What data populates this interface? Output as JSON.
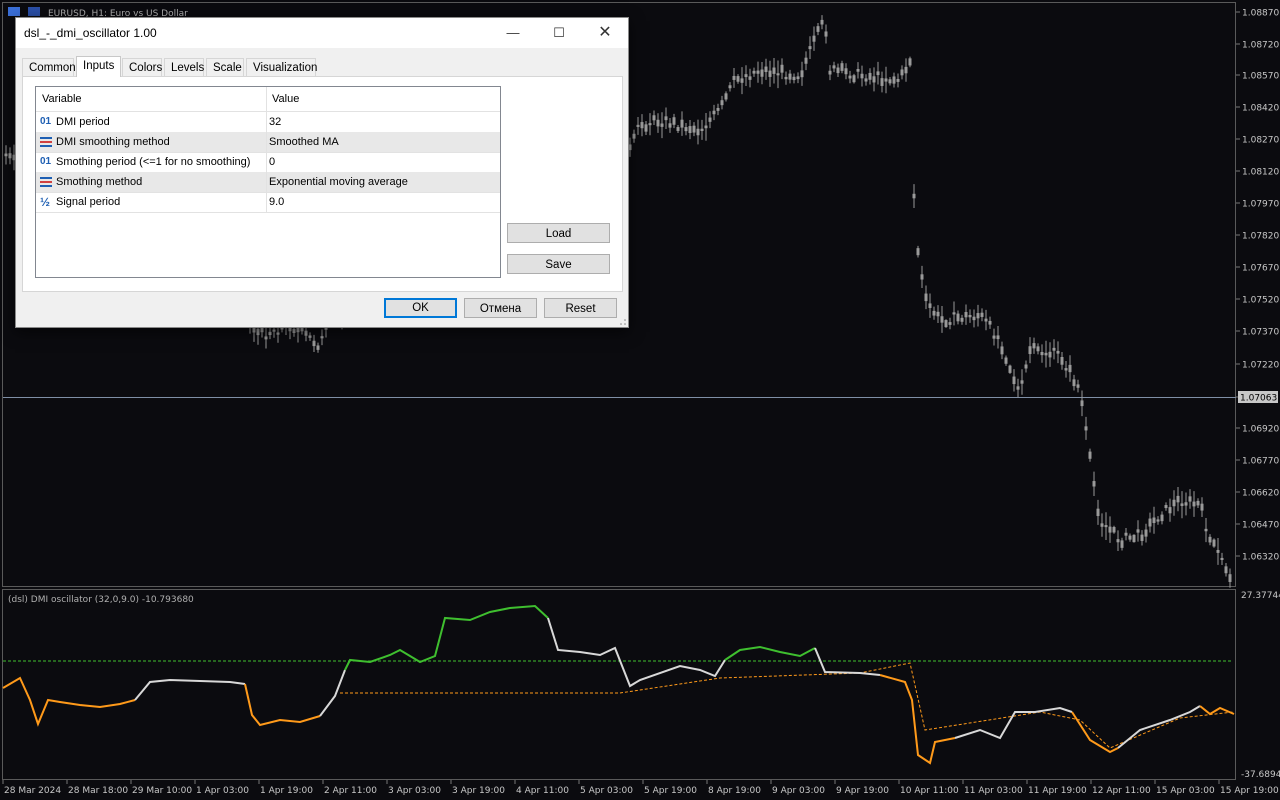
{
  "chart_window": {
    "title": "EURUSD, H1:  Euro vs US Dollar",
    "current_price": "1.07063",
    "price_labels": [
      "1.08870",
      "1.08720",
      "1.08570",
      "1.08420",
      "1.08270",
      "1.08120",
      "1.07970",
      "1.07820",
      "1.07670",
      "1.07520",
      "1.07370",
      "1.07220",
      "1.07063",
      "1.06920",
      "1.06770",
      "1.06620",
      "1.06470",
      "1.06320"
    ],
    "time_labels": [
      "28 Mar 2024",
      "28 Mar 18:00",
      "29 Mar 10:00",
      "1 Apr 03:00",
      "1 Apr 19:00",
      "2 Apr 11:00",
      "3 Apr 03:00",
      "3 Apr 19:00",
      "4 Apr 11:00",
      "5 Apr 03:00",
      "5 Apr 19:00",
      "8 Apr 19:00",
      "9 Apr 03:00",
      "9 Apr 19:00",
      "10 Apr 11:00",
      "11 Apr 03:00",
      "11 Apr 19:00",
      "12 Apr 11:00",
      "15 Apr 03:00",
      "15 Apr 19:00"
    ],
    "colors": {
      "background": "#0b0b0f",
      "candles": "#9a9a9a",
      "grid": "#2a2a2a",
      "price_line": "#7f8fa6"
    }
  },
  "indicator": {
    "label": "(dsl) DMI oscillator  (32,0,9.0) -10.793680",
    "scale_top": "27.37744",
    "scale_bottom": "-37.68944",
    "colors": {
      "up": "#3fbf2f",
      "down": "#ff9a1a",
      "neutral": "#d8d8d8",
      "upper_level": "#3fbf2f",
      "lower_level": "#ff9a1a"
    }
  },
  "dialog": {
    "title": "dsl_-_dmi_oscillator 1.00",
    "tabs": [
      {
        "label": "Common"
      },
      {
        "label": "Inputs"
      },
      {
        "label": "Colors"
      },
      {
        "label": "Levels"
      },
      {
        "label": "Scale"
      },
      {
        "label": "Visualization"
      }
    ],
    "active_tab": "Inputs",
    "grid_headers": {
      "variable": "Variable",
      "value": "Value"
    },
    "params": [
      {
        "icon": "01",
        "variable": "DMI period",
        "value": "32"
      },
      {
        "icon": "enum",
        "variable": "DMI smoothing method",
        "value": "Smoothed MA"
      },
      {
        "icon": "01",
        "variable": "Smothing period (<=1 for no smoothing)",
        "value": "0"
      },
      {
        "icon": "enum",
        "variable": "Smothing method",
        "value": "Exponential moving average"
      },
      {
        "icon": "½",
        "variable": "Signal period",
        "value": "9.0"
      }
    ],
    "buttons": {
      "load": "Load",
      "save": "Save",
      "ok": "OK",
      "cancel": "Отмена",
      "reset": "Reset"
    }
  }
}
